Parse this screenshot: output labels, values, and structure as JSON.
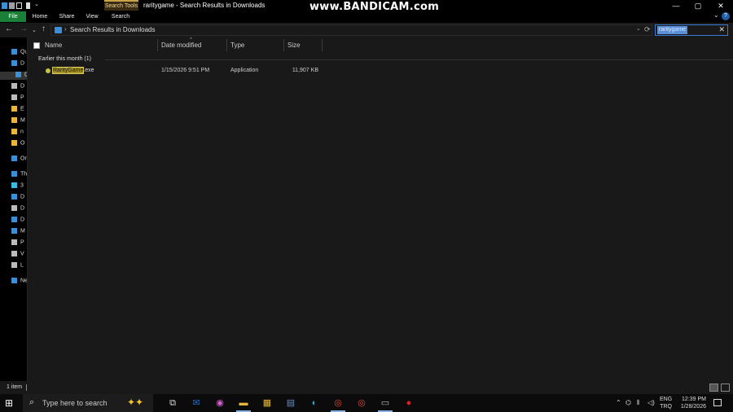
{
  "window": {
    "title": "raritygame - Search Results in Downloads",
    "context_tab": "Search Tools",
    "watermark": "www.BANDICAM.com",
    "controls": {
      "minimize": "—",
      "maximize": "▢",
      "close": "✕"
    }
  },
  "quick_access": {
    "dropdown": "⌄"
  },
  "ribbon": {
    "tabs": [
      {
        "label": "File"
      },
      {
        "label": "Home"
      },
      {
        "label": "Share"
      },
      {
        "label": "View"
      },
      {
        "label": "Search"
      }
    ],
    "expand": "⌄",
    "help": "?"
  },
  "navbar": {
    "back": "←",
    "forward": "→",
    "recent": "⌄",
    "up": "↑",
    "address_sep": "›",
    "address": "Search Results in Downloads",
    "address_dropdown": "⌄",
    "refresh": "⟳",
    "search_value": "raritygame",
    "search_clear": "✕"
  },
  "navpane": {
    "items": [
      {
        "label": "Qu",
        "icon": "star-icon",
        "color": "#3b8fd6"
      },
      {
        "label": "D",
        "icon": "desktop-icon",
        "color": "#3b8fd6"
      },
      {
        "label": "D",
        "icon": "download-icon",
        "color": "#3b8fd6",
        "selected": true
      },
      {
        "label": "D",
        "icon": "documents-icon",
        "color": "#bbbbbb"
      },
      {
        "label": "P",
        "icon": "pictures-icon",
        "color": "#bbbbbb"
      },
      {
        "label": "E",
        "icon": "folder-icon",
        "color": "#e8b73a"
      },
      {
        "label": "M",
        "icon": "folder-icon",
        "color": "#e8b73a"
      },
      {
        "label": "n",
        "icon": "folder-icon",
        "color": "#e8b73a"
      },
      {
        "label": "O",
        "icon": "folder-icon",
        "color": "#e8b73a"
      },
      {
        "label": "On",
        "icon": "onedrive-icon",
        "color": "#3b8fd6"
      },
      {
        "label": "Th",
        "icon": "this-pc-icon",
        "color": "#3b8fd6"
      },
      {
        "label": "3",
        "icon": "3d-objects-icon",
        "color": "#3bbbe0"
      },
      {
        "label": "D",
        "icon": "desktop-icon",
        "color": "#3b8fd6"
      },
      {
        "label": "D",
        "icon": "documents-icon",
        "color": "#bbbbbb"
      },
      {
        "label": "D",
        "icon": "download-icon",
        "color": "#3b8fd6"
      },
      {
        "label": "M",
        "icon": "music-icon",
        "color": "#3b8fd6"
      },
      {
        "label": "P",
        "icon": "pictures-icon",
        "color": "#bbbbbb"
      },
      {
        "label": "V",
        "icon": "videos-icon",
        "color": "#bbbbbb"
      },
      {
        "label": "L",
        "icon": "local-disk-icon",
        "color": "#bbbbbb"
      },
      {
        "label": "Ne",
        "icon": "network-icon",
        "color": "#3b8fd6"
      }
    ]
  },
  "columns": {
    "name": "Name",
    "date": "Date modified",
    "type": "Type",
    "size": "Size",
    "sort_caret": "^"
  },
  "group": {
    "label": "Earlier this month (1)"
  },
  "files": [
    {
      "name_highlight": "RarityGame",
      "name_rest": ".exe",
      "date": "1/15/2026 9:51 PM",
      "type": "Application",
      "size": "11,907 KB"
    }
  ],
  "status": {
    "count": "1 item"
  },
  "taskbar": {
    "start": "⊞",
    "search_icon": "⌕",
    "search_placeholder": "Type here to search",
    "sparkle": "✦✦",
    "apps": [
      {
        "name": "task-view-icon",
        "glyph": "⧉",
        "color": "#dddddd"
      },
      {
        "name": "mail-icon",
        "glyph": "✉",
        "color": "#1e6fd0"
      },
      {
        "name": "copilot-icon",
        "glyph": "◉",
        "color": "#d45fd0"
      },
      {
        "name": "file-explorer-icon",
        "glyph": "▬",
        "color": "#e8b73a",
        "active": true
      },
      {
        "name": "store-icon",
        "glyph": "▦",
        "color": "#e8b73a"
      },
      {
        "name": "app-icon",
        "glyph": "▤",
        "color": "#6a8fc0"
      },
      {
        "name": "edge-icon",
        "glyph": "◐",
        "color": "#2aa6d8"
      },
      {
        "name": "chrome-icon",
        "glyph": "◎",
        "color": "#e04b3a",
        "active": true
      },
      {
        "name": "chrome-icon",
        "glyph": "◎",
        "color": "#e04b3a"
      },
      {
        "name": "app-icon",
        "glyph": "▭",
        "color": "#bbbbbb",
        "active": true
      },
      {
        "name": "bandicam-icon",
        "glyph": "●",
        "color": "#e02020"
      }
    ],
    "tray": {
      "chevron": "⌃",
      "network": "⌬",
      "mic": "⦀",
      "volume": "◁)",
      "lang_line1": "ENG",
      "lang_line2": "TRQ",
      "time": "12:39 PM",
      "date": "1/28/2026"
    }
  }
}
